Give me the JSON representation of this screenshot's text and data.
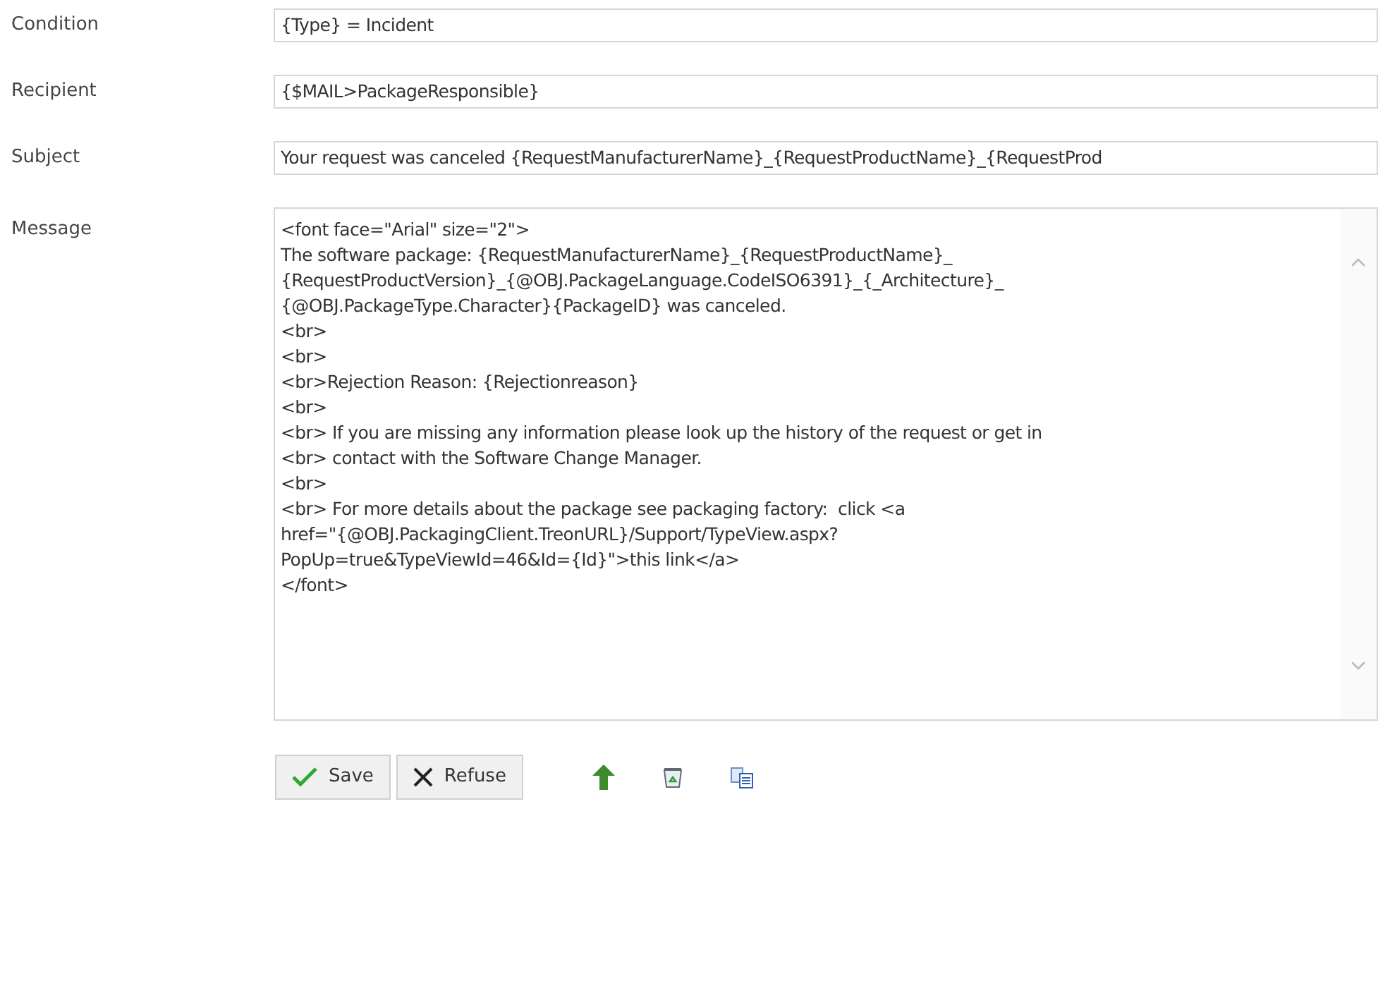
{
  "fields": [
    {
      "label": "Condition",
      "value": "{Type} = Incident"
    },
    {
      "label": "Recipient",
      "value": "{$MAIL>PackageResponsible}"
    },
    {
      "label": "Subject",
      "value": "Your request was canceled {RequestManufacturerName}_{RequestProductName}_{RequestProd"
    }
  ],
  "message": {
    "label": "Message",
    "lines": [
      "<font face=\"Arial\" size=\"2\">",
      "The software package: {RequestManufacturerName}_{RequestProductName}_",
      "{RequestProductVersion}_{@OBJ.PackageLanguage.CodeISO6391}_{_Architecture}_",
      "{@OBJ.PackageType.Character}{PackageID} was canceled.",
      "<br>",
      "<br>",
      "<br>Rejection Reason: {Rejectionreason}",
      "<br>",
      "<br> If you are missing any information please look up the history of the request or get in",
      "<br> contact with the Software Change Manager.",
      "<br>",
      "<br> For more details about the package see packaging factory:  click <a",
      "href=\"{@OBJ.PackagingClient.TreonURL}/Support/TypeView.aspx?",
      "PopUp=true&TypeViewId=46&Id={Id}\">this link</a>",
      "</font>"
    ]
  },
  "buttons": [
    {
      "kind": "save",
      "label": "Save"
    },
    {
      "kind": "refuse",
      "label": "Refuse"
    }
  ],
  "tools": [
    {
      "kind": "up"
    },
    {
      "kind": "delete"
    },
    {
      "kind": "copy"
    }
  ]
}
